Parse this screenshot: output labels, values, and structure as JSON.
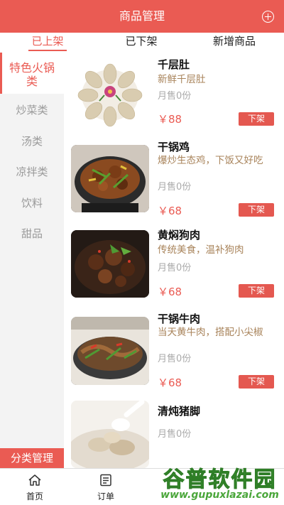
{
  "header": {
    "title": "商品管理",
    "add_icon": "plus-circle-icon"
  },
  "tabs": [
    {
      "label": "已上架",
      "active": true
    },
    {
      "label": "已下架",
      "active": false
    },
    {
      "label": "新增商品",
      "active": false
    }
  ],
  "sidebar": {
    "items": [
      {
        "label": "特色火锅类",
        "active": true
      },
      {
        "label": "炒菜类",
        "active": false
      },
      {
        "label": "汤类",
        "active": false
      },
      {
        "label": "凉拌类",
        "active": false
      },
      {
        "label": "饮料",
        "active": false
      },
      {
        "label": "甜品",
        "active": false
      }
    ],
    "manage_label": "分类管理"
  },
  "products": [
    {
      "name": "千层肚",
      "desc": "新鲜千层肚",
      "sales": "月售0份",
      "price": "￥88",
      "action": "下架"
    },
    {
      "name": "干锅鸡",
      "desc": "爆炒生态鸡，下饭又好吃",
      "sales": "月售0份",
      "price": "￥68",
      "action": "下架"
    },
    {
      "name": "黄焖狗肉",
      "desc": "传统美食，温补狗肉",
      "sales": "月售0份",
      "price": "￥68",
      "action": "下架"
    },
    {
      "name": "干锅牛肉",
      "desc": "当天黄牛肉，搭配小尖椒",
      "sales": "月售0份",
      "price": "￥68",
      "action": "下架"
    },
    {
      "name": "清炖猪脚",
      "desc": "",
      "sales": "月售0份",
      "price": "",
      "action": ""
    }
  ],
  "bottom_nav": [
    {
      "label": "首页",
      "icon": "home-icon"
    },
    {
      "label": "订单",
      "icon": "order-icon"
    }
  ],
  "watermark": {
    "text": "谷普软件园",
    "url": "www.gupuxlazai.com"
  },
  "colors": {
    "accent": "#ea5b53",
    "desc_text": "#a8835a",
    "sidebar_bg": "#f3f3f3"
  }
}
